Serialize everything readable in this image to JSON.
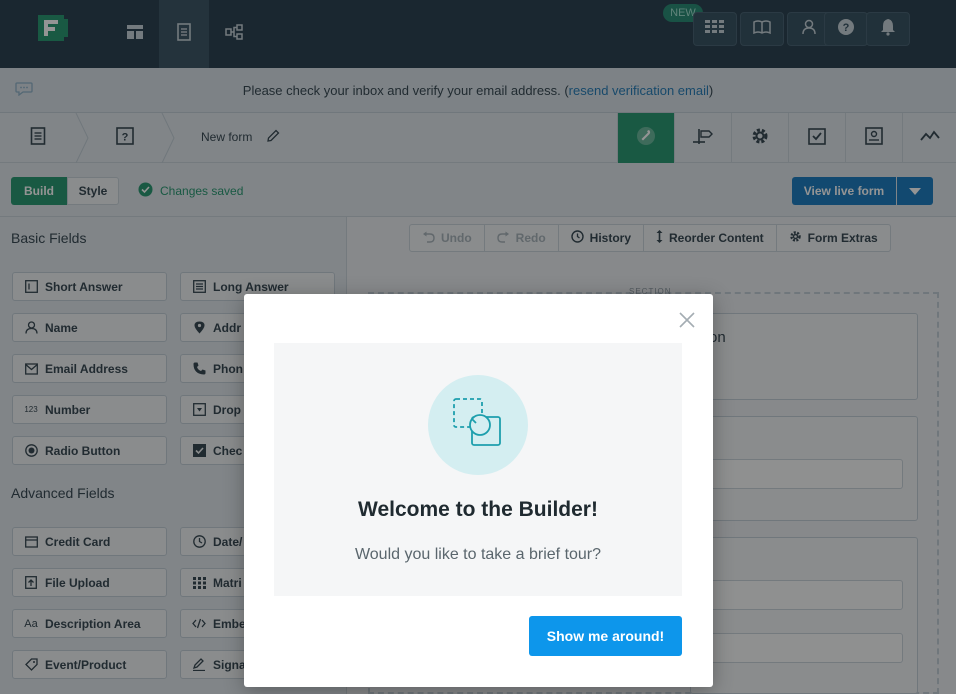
{
  "topnav": {
    "new_badge": "NEW",
    "tabs": [
      {
        "icon": "dashboard-icon"
      },
      {
        "icon": "form-icon",
        "active": true
      },
      {
        "icon": "workflow-icon"
      }
    ],
    "right_icons": [
      "apps-grid-icon",
      "book-icon",
      "user-icon",
      "help-icon",
      "bell-icon"
    ]
  },
  "banner": {
    "text_before": "Please check your inbox and verify your email address. (",
    "link": "resend verification email",
    "text_after": ")"
  },
  "breadcrumb": {
    "form_name": "New form"
  },
  "toolbar": {
    "tools": [
      "wrench-icon",
      "signpost-icon",
      "gear-icon",
      "checkbox-icon",
      "record-icon",
      "analytics-icon"
    ],
    "accent": "#2c9a74"
  },
  "buildbar": {
    "build_label": "Build",
    "style_label": "Style",
    "saved_text": "Changes saved",
    "view_live_label": "View live form"
  },
  "left_panel": {
    "basic_heading": "Basic Fields",
    "advanced_heading": "Advanced Fields",
    "basic_fields": [
      {
        "label": "Short Answer",
        "icon": "short-answer-icon"
      },
      {
        "label": "Long Answer",
        "icon": "long-answer-icon"
      },
      {
        "label": "Name",
        "icon": "name-icon"
      },
      {
        "label": "Addr",
        "icon": "address-icon"
      },
      {
        "label": "Email Address",
        "icon": "email-icon"
      },
      {
        "label": "Phon",
        "icon": "phone-icon"
      },
      {
        "label": "Number",
        "icon": "number-icon",
        "glyph": "123"
      },
      {
        "label": "Drop",
        "icon": "dropdown-icon"
      },
      {
        "label": "Radio Button",
        "icon": "radio-icon"
      },
      {
        "label": "Chec",
        "icon": "checkbox-icon"
      }
    ],
    "advanced_fields": [
      {
        "label": "Credit Card",
        "icon": "credit-card-icon"
      },
      {
        "label": "Date/",
        "icon": "clock-icon"
      },
      {
        "label": "File Upload",
        "icon": "file-upload-icon"
      },
      {
        "label": "Matri",
        "icon": "matrix-icon"
      },
      {
        "label": "Description Area",
        "icon": "description-icon",
        "glyph": "Aa"
      },
      {
        "label": "Embe",
        "icon": "embed-icon"
      },
      {
        "label": "Event/Product",
        "icon": "tag-icon"
      },
      {
        "label": "Signa",
        "icon": "signature-icon"
      }
    ]
  },
  "right_tools": {
    "undo": "Undo",
    "redo": "Redo",
    "history": "History",
    "reorder": "Reorder Content",
    "extras": "Form Extras"
  },
  "canvas": {
    "section_label": "SECTION",
    "partial_text": "on"
  },
  "modal": {
    "title": "Welcome to the Builder!",
    "subtitle": "Would you like to take a brief tour?",
    "cta": "Show me around!",
    "hero_icon": "drag-drop-icon"
  }
}
